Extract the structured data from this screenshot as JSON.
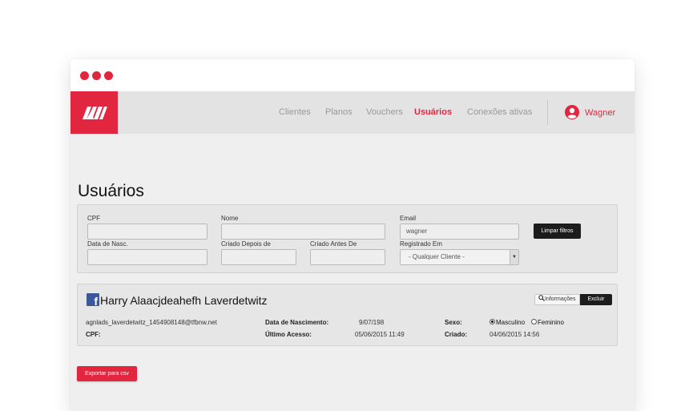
{
  "window": {
    "dots_color": "#e0263f"
  },
  "header": {
    "logo_color": "#e3263f",
    "nav": [
      {
        "label": "Clientes",
        "active": false
      },
      {
        "label": "Planos",
        "active": false
      },
      {
        "label": "Vouchers",
        "active": false
      },
      {
        "label": "Usuários",
        "active": true
      },
      {
        "label": "Conexões ativas",
        "active": false
      }
    ],
    "user": {
      "name": "Wagner",
      "icon": "user-circle-icon"
    }
  },
  "page": {
    "title": "Usuários"
  },
  "filters": {
    "cpf": {
      "label": "CPF",
      "value": ""
    },
    "nome": {
      "label": "Nome",
      "value": ""
    },
    "email": {
      "label": "Email",
      "value": "wagner"
    },
    "data_nasc": {
      "label": "Data de Nasc.",
      "value": ""
    },
    "criado_depois": {
      "label": "Criado Depois de",
      "value": ""
    },
    "criado_antes": {
      "label": "Criado Antes De",
      "value": ""
    },
    "registrado_em": {
      "label": "Registrado Em",
      "value": "- Qualquer Cliente -"
    },
    "clear_button": "Limpar filtros"
  },
  "result": {
    "source_icon": "facebook-icon",
    "name": "Harry Alaacjdeahefh Laverdetwitz",
    "info_button": "Informações",
    "delete_button": "Excluir",
    "email": "agnlads_laverdetwitz_1454908148@tfbnw.net",
    "cpf_label": "CPF:",
    "birth_label": "Data de Nascimento:",
    "birth_value": "9/07/198",
    "last_access_label": "Último Acesso:",
    "last_access_value": "05/06/2015 11:49",
    "sex_label": "Sexo:",
    "sex_options": [
      "Masculino",
      "Feminino"
    ],
    "sex_selected": "Masculino",
    "created_label": "Criado:",
    "created_value": "04/06/2015 14:56"
  },
  "export_button": "Exportar para csv"
}
